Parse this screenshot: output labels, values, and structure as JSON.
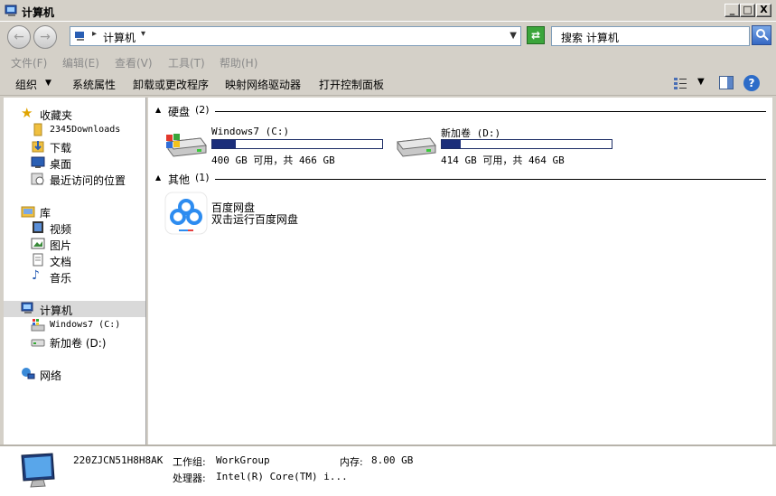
{
  "window": {
    "title": "计算机",
    "controls": {
      "minimize": "_",
      "maximize": "□",
      "close": "X"
    }
  },
  "address": {
    "breadcrumb": "计算机",
    "search_placeholder": "搜索 计算机"
  },
  "menubar": {
    "items": [
      "文件(F)",
      "编辑(E)",
      "查看(V)",
      "工具(T)",
      "帮助(H)"
    ]
  },
  "toolbar": {
    "organize": "组织",
    "system_properties": "系统属性",
    "uninstall": "卸载或更改程序",
    "map_drive": "映射网络驱动器",
    "control_panel": "打开控制面板"
  },
  "sidebar": {
    "favorites": "收藏夹",
    "fav_2345": "2345Downloads",
    "fav_downloads": "下载",
    "fav_desktop": "桌面",
    "fav_recent": "最近访问的位置",
    "libraries": "库",
    "lib_video": "视频",
    "lib_pictures": "图片",
    "lib_documents": "文档",
    "lib_music": "音乐",
    "computer": "计算机",
    "drive_c": "Windows7 (C:)",
    "drive_d": "新加卷 (D:)",
    "network": "网络"
  },
  "content": {
    "hard_disks": {
      "title": "硬盘",
      "count": "(2)"
    },
    "drives": [
      {
        "name": "Windows7 (C:)",
        "free_text": "400 GB 可用，共 466 GB",
        "used_fraction": 0.14
      },
      {
        "name": "新加卷 (D:)",
        "free_text": "414 GB 可用，共 464 GB",
        "used_fraction": 0.11
      }
    ],
    "other": {
      "title": "其他",
      "count": "(1)"
    },
    "baidu": {
      "name": "百度网盘",
      "desc": "双击运行百度网盘"
    }
  },
  "statusbar": {
    "computer_name": "220ZJCN51H8H8AK",
    "workgroup_label": "工作组:",
    "workgroup": "WorkGroup",
    "memory_label": "内存:",
    "memory": "8.00 GB",
    "cpu_label": "处理器:",
    "cpu": "Intel(R) Core(TM) i..."
  },
  "colors": {
    "chrome": "#d4d0c8",
    "usage_bar": "#1b2e7a",
    "baidu_blue": "#2d8cf0"
  }
}
